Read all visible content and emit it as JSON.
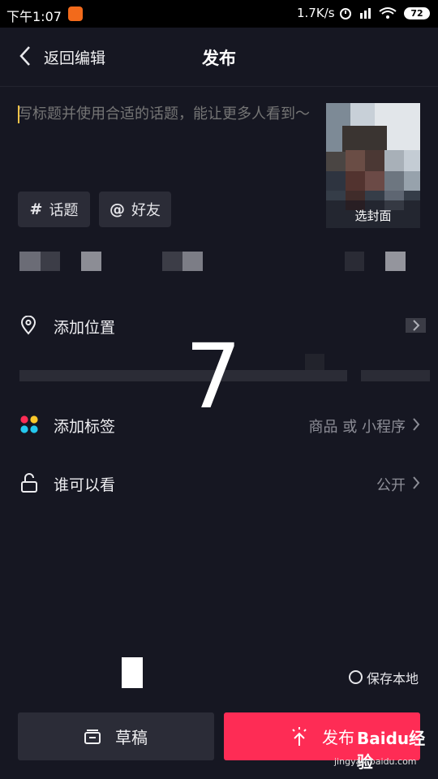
{
  "status_bar": {
    "time": "下午1:07",
    "network_speed": "1.7K/s",
    "battery": "72"
  },
  "header": {
    "back_label": "返回编辑",
    "title": "发布"
  },
  "caption": {
    "placeholder": "写标题并使用合适的话题，能让更多人看到～"
  },
  "cover": {
    "label": "选封面"
  },
  "chips": {
    "topic_symbol": "#",
    "topic_label": "话题",
    "friend_symbol": "@",
    "friend_label": "好友"
  },
  "rows": {
    "location_label": "添加位置",
    "tag_label": "添加标签",
    "tag_value": "商品 或 小程序",
    "visibility_label": "谁可以看",
    "visibility_value": "公开"
  },
  "overlay_number": "7",
  "bottom": {
    "save_local_label": "保存本地",
    "draft_label": "草稿",
    "publish_label": "发布"
  },
  "watermark": {
    "text": "Baidu经验",
    "url": "jingyan.baidu.com"
  },
  "colors": {
    "background": "#161722",
    "accent": "#fe2c55",
    "chip": "#2b2c37",
    "cursor": "#f3c34a"
  }
}
